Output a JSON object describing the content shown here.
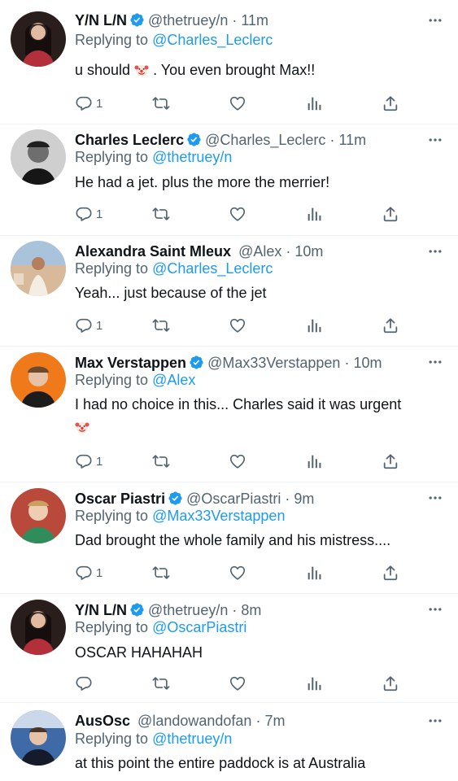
{
  "colors": {
    "accent": "#1d9bf0",
    "secondary_text": "#536471",
    "text": "#0f1419",
    "divider": "#eff3f4"
  },
  "tweets": [
    {
      "name": "Y/N L/N",
      "verified": true,
      "handle": "@thetruey/n",
      "time": "11m",
      "replying_label": "Replying to",
      "replying_to": "@Charles_Leclerc",
      "text_before_emoji": "u should ",
      "emoji": "clown-face-emoji",
      "text_after_emoji": " . You even brought Max!!",
      "reply_count": "1"
    },
    {
      "name": "Charles Leclerc",
      "verified": true,
      "handle": "@Charles_Leclerc",
      "time": "11m",
      "replying_label": "Replying to",
      "replying_to": "@thetruey/n",
      "text": "He had a jet. plus the more the merrier!",
      "reply_count": "1"
    },
    {
      "name": "Alexandra Saint Mleux",
      "verified": false,
      "handle": "@Alex",
      "time": "10m",
      "replying_label": "Replying to",
      "replying_to": "@Charles_Leclerc",
      "text": "Yeah... just because of the jet",
      "reply_count": "1"
    },
    {
      "name": "Max Verstappen",
      "verified": true,
      "handle": "@Max33Verstappen",
      "time": "10m",
      "replying_label": "Replying to",
      "replying_to": "@Alex",
      "text": "I had no choice in this... Charles said it was urgent",
      "emoji": "clown-face-emoji",
      "reply_count": "1"
    },
    {
      "name": "Oscar Piastri",
      "verified": true,
      "handle": "@OscarPiastri",
      "time": "9m",
      "replying_label": "Replying to",
      "replying_to": "@Max33Verstappen",
      "text": "Dad brought the whole family and his mistress....",
      "reply_count": "1"
    },
    {
      "name": "Y/N L/N",
      "verified": true,
      "handle": "@thetruey/n",
      "time": "8m",
      "replying_label": "Replying to",
      "replying_to": "@OscarPiastri",
      "text": "OSCAR HAHAHAH",
      "reply_count": ""
    },
    {
      "name": "AusOsc",
      "verified": false,
      "handle": "@landowandofan",
      "time": "7m",
      "replying_label": "Replying to",
      "replying_to": "@thetruey/n",
      "text": "at this point the entire paddock is at Australia"
    }
  ],
  "separator": "·",
  "icons": {
    "reply": "reply-icon",
    "retweet": "retweet-icon",
    "like": "heart-icon",
    "views": "views-icon",
    "share": "share-icon",
    "more": "more-icon",
    "verified": "verified-badge-icon"
  }
}
